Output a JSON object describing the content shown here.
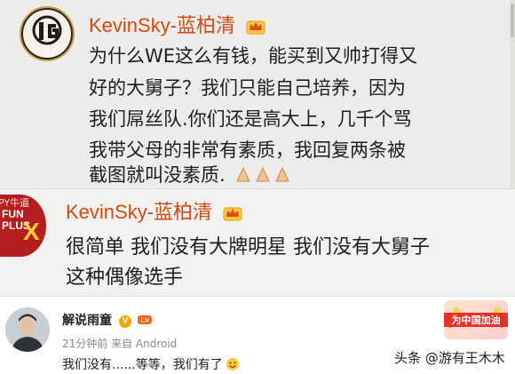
{
  "post1": {
    "avatar_text": "iG必胜",
    "username": "KevinSky-蓝柏清",
    "badge_icon": "crown-icon",
    "lines": [
      "为什么WE这么有钱，能买到又帅打得又",
      "好的大舅子？我们只能自己培养，因为",
      "我们屌丝队.你们还是高大上，几千个骂",
      "我带父母的非常有素质，我回复两条被",
      "截图就叫没素质."
    ],
    "emoji_icon": "praying-hands-icon"
  },
  "post2": {
    "avatar_top_text": "PY牛逼",
    "avatar_logo_line1": "FUN",
    "avatar_logo_line2": "PLUS",
    "avatar_logo_x": "X",
    "username": "KevinSky-蓝柏清",
    "badge_icon": "crown-icon",
    "lines": [
      "很简单 我们没有大牌明星 我们没有大舅子",
      "这种偶像选手"
    ]
  },
  "post3": {
    "username": "解说雨童",
    "verified_icon": "verified-v-icon",
    "level_badge": "Lv",
    "meta": "21分钟前 来自 Android",
    "text": "我们没有......等等，我们有了",
    "emoji_icon": "smile-emoji-icon",
    "promo_text": "为中国加油",
    "watermark": "头条 @游有王木木"
  },
  "colors": {
    "name_orange": "#d9480f",
    "crown_gold": "#f0a500",
    "meta_gray": "#8a8a8a"
  }
}
